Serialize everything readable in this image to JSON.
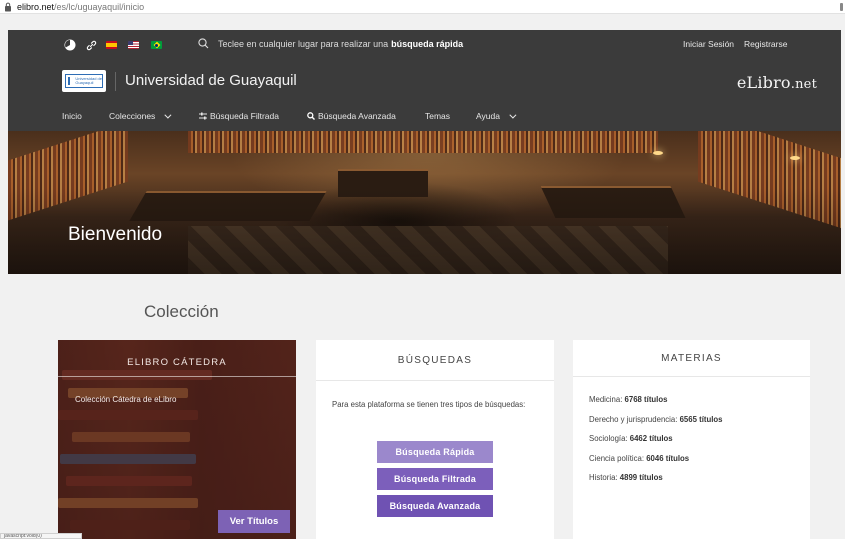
{
  "browser": {
    "url_host": "elibro.net",
    "url_path": "/es/lc/uguayaquil/inicio",
    "status_text": "javascript:void(0)"
  },
  "header": {
    "search_hint_prefix": "Teclee en cualquier lugar para realizar una",
    "search_hint_bold": "búsqueda rápida",
    "login": "Iniciar Sesión",
    "register": "Registrarse",
    "university_name": "Universidad de Guayaquil",
    "university_logo_text": "Universidad de Guayaquil",
    "brand_main": "eLibro",
    "brand_suffix": ".net",
    "flags": [
      "es",
      "us",
      "br"
    ]
  },
  "nav": {
    "items": [
      {
        "label": "Inicio"
      },
      {
        "label": "Colecciones"
      },
      {
        "label": "Búsqueda Filtrada"
      },
      {
        "label": "Búsqueda Avanzada"
      },
      {
        "label": "Temas"
      },
      {
        "label": "Ayuda"
      }
    ]
  },
  "hero": {
    "title": "Bienvenido"
  },
  "section": {
    "title": "Colección"
  },
  "cards": {
    "catedra": {
      "title": "ELIBRO CÁTEDRA",
      "description": "Colección Cátedra de eLibro",
      "button": "Ver Títulos"
    },
    "busquedas": {
      "title": "BÚSQUEDAS",
      "text": "Para esta plataforma se tienen tres tipos de búsquedas:",
      "buttons": [
        "Búsqueda Rápida",
        "Búsqueda Filtrada",
        "Búsqueda Avanzada"
      ]
    },
    "materias": {
      "title": "MATERIAS",
      "items": [
        {
          "name": "Medicina:",
          "count": "6768 títulos"
        },
        {
          "name": "Derecho y jurisprudencia:",
          "count": "6565 títulos"
        },
        {
          "name": "Sociología:",
          "count": "6462 títulos"
        },
        {
          "name": "Ciencia política:",
          "count": "6046 títulos"
        },
        {
          "name": "Historia:",
          "count": "4899 títulos"
        }
      ]
    }
  },
  "colors": {
    "header_bg": "#3b3b3b",
    "accent_purple": "#7c5fbb",
    "accent_light_purple": "#9b88cc",
    "page_bg": "#f1f1f1"
  }
}
